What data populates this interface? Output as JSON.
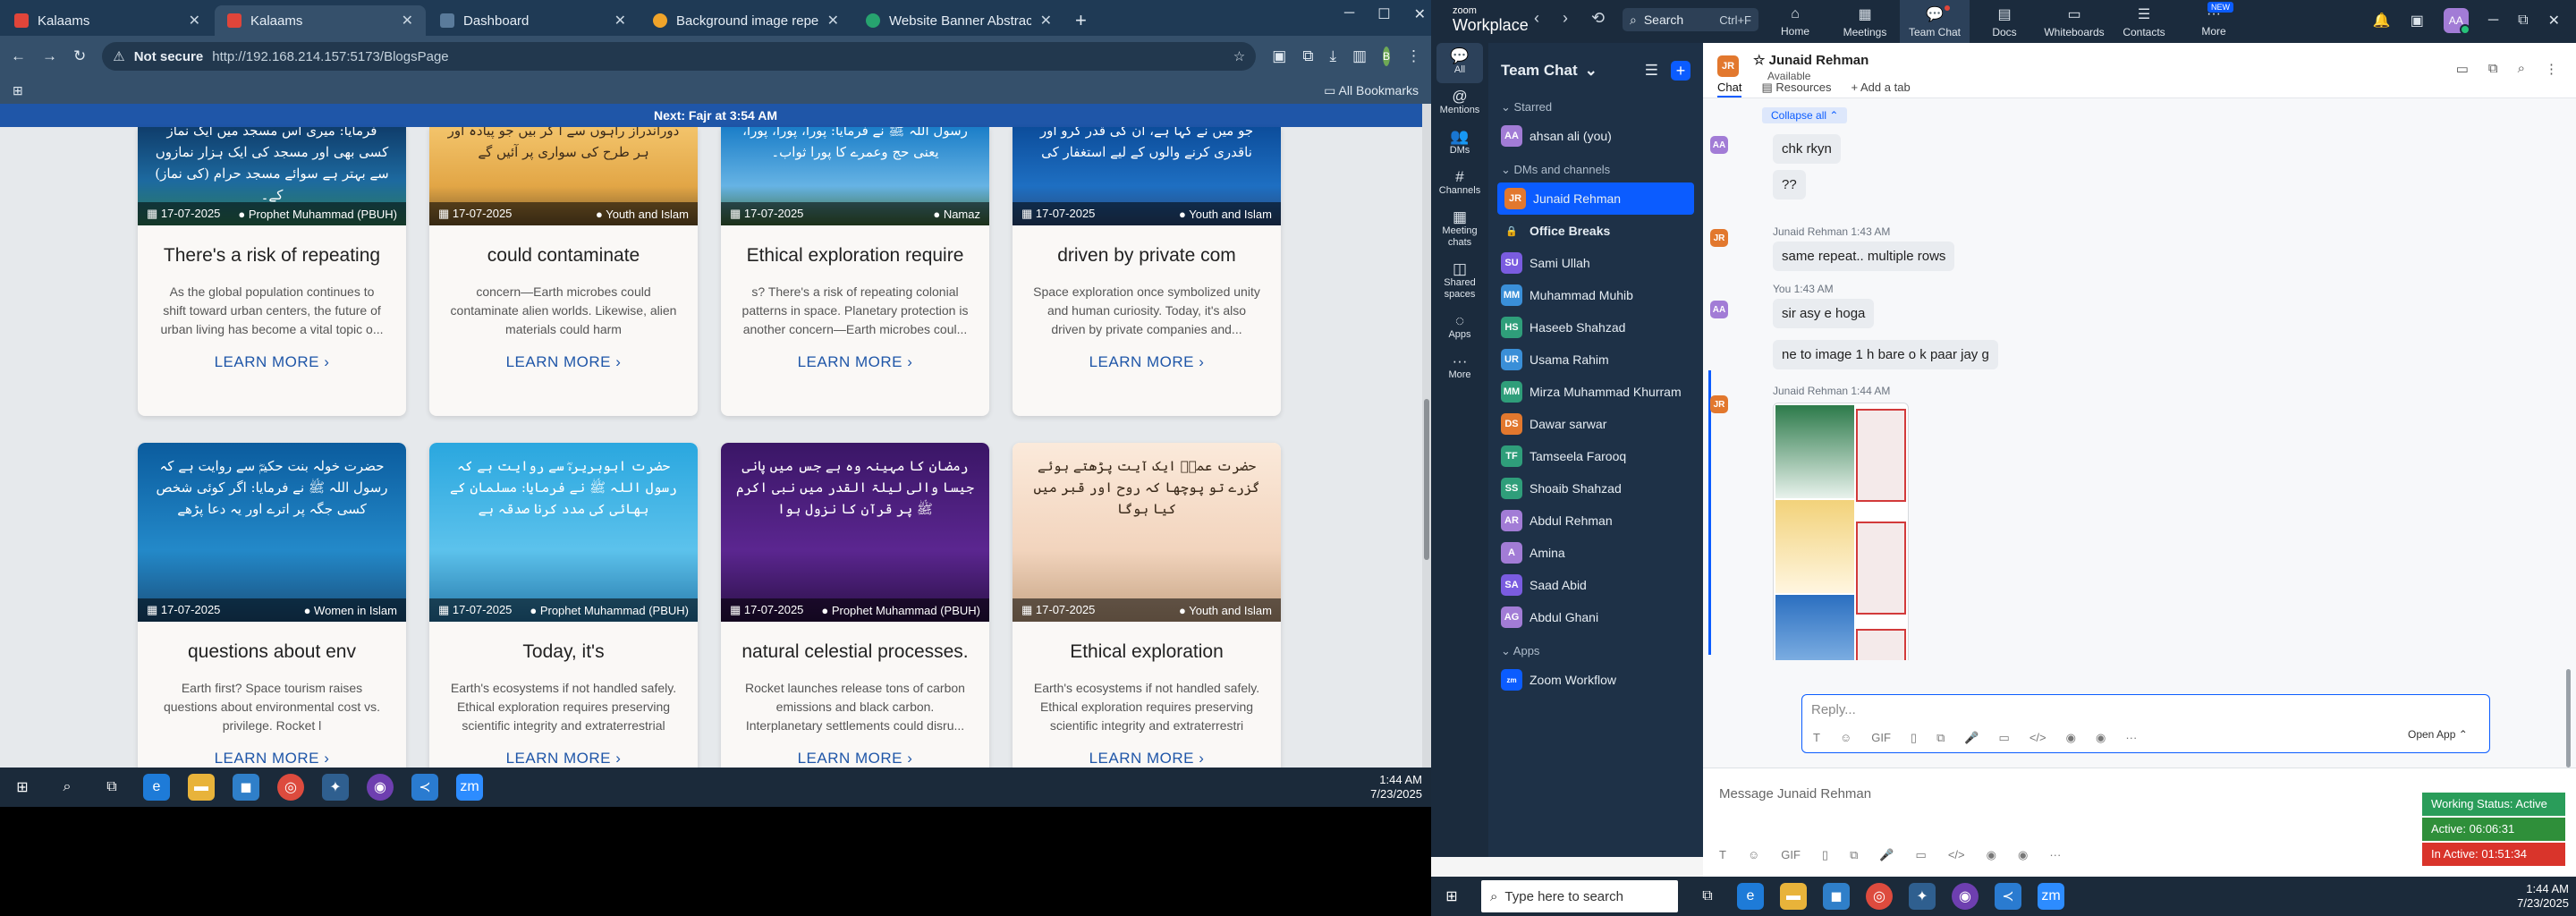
{
  "browser": {
    "tabs": [
      {
        "label": "Kalaams",
        "color": "#e0453a"
      },
      {
        "label": "Kalaams",
        "color": "#e0453a"
      },
      {
        "label": "Dashboard",
        "color": "#5a7b9b"
      },
      {
        "label": "Background image repeat",
        "color": "#f0a42a"
      },
      {
        "label": "Website Banner Abstract Purpl",
        "color": "#27a36f"
      }
    ],
    "url_status": "Not secure",
    "url": "http://192.168.214.157:5173/BlogsPage",
    "profile": "B",
    "bookmarks_label": "All Bookmarks"
  },
  "page": {
    "banner": "Next: Fajr at 3:54 AM",
    "cards": [
      {
        "date": "17-07-2025",
        "category": "Prophet Muhammad (PBUH)",
        "title": "There's a risk of repeating",
        "excerpt": "As the global population continues to shift toward urban centers, the future of urban living has become a vital topic o...",
        "more": "LEARN MORE ›",
        "urdu": "فرمایا: میری اس مسجد میں ایک نماز کسی بھی اور مسجد کی ایک ہزار نمازوں سے بہتر ہے سوائے مسجد حرام (کی نماز) کے۔"
      },
      {
        "date": "17-07-2025",
        "category": "Youth and Islam",
        "title": "could contaminate",
        "excerpt": "concern—Earth microbes could contaminate alien worlds. Likewise, alien materials could harm",
        "more": "LEARN MORE ›",
        "urdu": "دوراندراز راہوں سے آ کر بیں جو پیادہ اور ہر طرح کی سواری پر آئیں گے"
      },
      {
        "date": "17-07-2025",
        "category": "Namaz",
        "title": "Ethical exploration require",
        "excerpt": "s? There's a risk of repeating colonial patterns in space. Planetary protection is another concern—Earth microbes coul...",
        "more": "LEARN MORE ›",
        "urdu": "رسول اللہ ﷺ نے فرمایا: پورا، پورا، پورا، یعنی حج وعمرے کا پورا ثواب۔"
      },
      {
        "date": "17-07-2025",
        "category": "Youth and Islam",
        "title": "driven by private com",
        "excerpt": "Space exploration once symbolized unity and human curiosity. Today, it's also driven by private companies and...",
        "more": "LEARN MORE ›",
        "urdu": "جو میں نے کہا ہے، ان کی قدر کرو اور ناقدری کرنے والوں کے لیے استغفار کی"
      },
      {
        "date": "17-07-2025",
        "category": "Women in Islam",
        "title": "questions about env",
        "excerpt": "Earth first? Space tourism raises questions about environmental cost vs. privilege. Rocket l",
        "more": "LEARN MORE ›",
        "urdu": "حضرت خولہ بنت حکیمؓ سے روایت ہے کہ رسول اللہ ﷺ نے فرمایا: اگر کوئی شخص کسی جگہ پر اترے اور یہ دعا پڑھے"
      },
      {
        "date": "17-07-2025",
        "category": "Prophet Muhammad (PBUH)",
        "title": "Today, it's",
        "excerpt": "Earth's ecosystems if not handled safely. Ethical exploration requires preserving scientific integrity and extraterrestrial",
        "more": "LEARN MORE ›",
        "urdu": "حضرت ابوہریرہؓ سے روایت ہے کہ رسول اللہ ﷺ نے فرمایا: مسلمان کے بھائی کی مدد کرنا صدقہ ہے"
      },
      {
        "date": "17-07-2025",
        "category": "Prophet Muhammad (PBUH)",
        "title": "natural celestial processes.",
        "excerpt": "Rocket launches release tons of carbon emissions and black carbon. Interplanetary settlements could disru...",
        "more": "LEARN MORE ›",
        "urdu": "رمضان کا مہینہ وہ ہے جس میں پانی جیسا والی لیلۃ القدر میں نبی اکرم ﷺ پر قرآن کا نزول ہوا"
      },
      {
        "date": "17-07-2025",
        "category": "Youth and Islam",
        "title": "Ethical exploration",
        "excerpt": "Earth's ecosystems if not handled safely. Ethical exploration requires preserving scientific integrity and extraterrestri",
        "more": "LEARN MORE ›",
        "urdu": "حضرت عمرؓ ایک آیت پڑھتے ہوئے گزرے تو پوچھا کہ روح اور قبر میں کیا ہوگا"
      }
    ]
  },
  "taskbar_left": {
    "time": "1:44 AM",
    "date": "7/23/2025"
  },
  "zoom": {
    "logo_top": "zoom",
    "logo_bottom": "Workplace",
    "search": "Search",
    "search_shortcut": "Ctrl+F",
    "tabs": [
      "Home",
      "Meetings",
      "Team Chat",
      "Docs",
      "Whiteboards",
      "Contacts",
      "More"
    ],
    "new_badge": "NEW",
    "user_avatar": "AA",
    "rail": [
      "All",
      "Mentions",
      "DMs",
      "Channels",
      "Meeting chats",
      "Shared spaces",
      "Apps",
      "More"
    ],
    "sidebar_title": "Team Chat",
    "starred": "Starred",
    "me": {
      "initials": "AA",
      "name": "ahsan ali (you)",
      "color": "#a27cd6"
    },
    "dms_channels": "DMs and channels",
    "contacts": [
      {
        "initials": "JR",
        "name": "Junaid Rehman",
        "color": "#e2782e"
      },
      {
        "initials": "🔒",
        "name": "Office Breaks",
        "color": "#1e3147"
      },
      {
        "initials": "SU",
        "name": "Sami Ullah",
        "color": "#7a5ce0"
      },
      {
        "initials": "MM",
        "name": "Muhammad Muhib",
        "color": "#3a8fd8"
      },
      {
        "initials": "HS",
        "name": "Haseeb Shahzad",
        "color": "#2f9e7a"
      },
      {
        "initials": "UR",
        "name": "Usama Rahim",
        "color": "#3a8fd8"
      },
      {
        "initials": "MM",
        "name": "Mirza Muhammad Khurram",
        "color": "#2f9e7a"
      },
      {
        "initials": "DS",
        "name": "Dawar sarwar",
        "color": "#e2782e"
      },
      {
        "initials": "TF",
        "name": "Tamseela Farooq",
        "color": "#2f9e7a"
      },
      {
        "initials": "SS",
        "name": "Shoaib Shahzad",
        "color": "#2f9e7a"
      },
      {
        "initials": "AR",
        "name": "Abdul Rehman",
        "color": "#a27cd6"
      },
      {
        "initials": "A",
        "name": "Amina",
        "color": "#a27cd6"
      },
      {
        "initials": "SA",
        "name": "Saad Abid",
        "color": "#7a5ce0"
      },
      {
        "initials": "AG",
        "name": "Abdul Ghani",
        "color": "#a27cd6"
      }
    ],
    "apps_label": "Apps",
    "apps": [
      {
        "name": "Zoom Workflow"
      }
    ],
    "chat": {
      "name": "Junaid Rehman",
      "status": "Available",
      "tab_chat": "Chat",
      "tab_resources": "Resources",
      "tab_add": "Add a tab",
      "collapse": "Collapse all ⌃",
      "messages": [
        {
          "sender": "",
          "text": "chk rkyn"
        },
        {
          "sender": "",
          "text": "??"
        },
        {
          "sender": "Junaid Rehman 1:43 AM",
          "text": "same repeat.. multiple rows"
        },
        {
          "sender": "You 1:43 AM",
          "text": "sir asy e hoga"
        },
        {
          "sender": "",
          "text": "ne to image 1 h bare o k paar jay g"
        },
        {
          "sender": "Junaid Rehman 1:44 AM",
          "text": ""
        }
      ],
      "reply_placeholder": "Reply...",
      "compose_placeholder": "Message Junaid Rehman",
      "open_app": "Open App ⌃"
    },
    "status": {
      "working": "Working Status: Active",
      "active": "Active: 06:06:31",
      "inactive": "In Active: 01:51:34"
    }
  },
  "taskbar_right": {
    "search": "Type here to search",
    "time": "1:44 AM",
    "date": "7/23/2025"
  }
}
